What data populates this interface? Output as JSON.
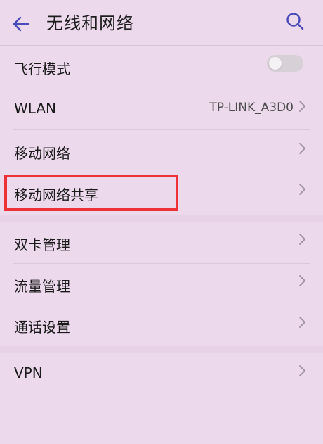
{
  "header": {
    "title": "无线和网络",
    "back_icon": "back-arrow-icon",
    "search_icon": "search-icon"
  },
  "settings": {
    "airplane_mode": {
      "label": "飞行模式",
      "enabled": false
    },
    "wlan": {
      "label": "WLAN",
      "value": "TP-LINK_A3D0"
    },
    "mobile_network": {
      "label": "移动网络"
    },
    "tethering": {
      "label": "移动网络共享"
    },
    "dual_sim": {
      "label": "双卡管理"
    },
    "data_usage": {
      "label": "流量管理"
    },
    "call_settings": {
      "label": "通话设置"
    },
    "vpn": {
      "label": "VPN"
    }
  },
  "colors": {
    "background": "#ecd9ec",
    "accent": "#4a4ab8",
    "highlight_border": "#ee3136",
    "chevron": "#9a8f9a"
  }
}
